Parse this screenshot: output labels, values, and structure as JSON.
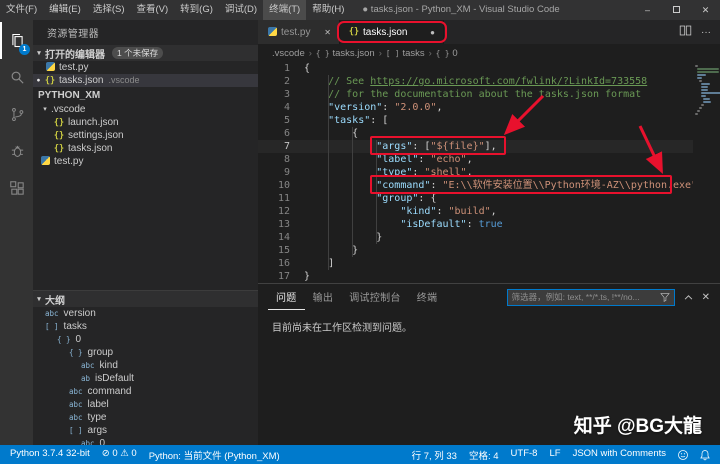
{
  "colors": {
    "accent": "#007acc",
    "annotation": "#e8112d"
  },
  "title_bar": {
    "menus": [
      {
        "id": "file",
        "label": "文件(F)"
      },
      {
        "id": "edit",
        "label": "编辑(E)"
      },
      {
        "id": "selection",
        "label": "选择(S)"
      },
      {
        "id": "view",
        "label": "查看(V)"
      },
      {
        "id": "go",
        "label": "转到(G)"
      },
      {
        "id": "debug",
        "label": "调试(D)"
      },
      {
        "id": "terminal",
        "label": "终端(T)",
        "highlight": true
      },
      {
        "id": "help",
        "label": "帮助(H)"
      }
    ],
    "window_title": "● tasks.json - Python_XM - Visual Studio Code"
  },
  "activity_bar": {
    "icons": [
      {
        "name": "explorer",
        "active": true,
        "badge": "1"
      },
      {
        "name": "search",
        "active": false
      },
      {
        "name": "source-control",
        "active": false
      },
      {
        "name": "debug",
        "active": false
      },
      {
        "name": "extensions",
        "active": false
      }
    ]
  },
  "explorer": {
    "title": "资源管理器",
    "open_editors": {
      "label": "打开的编辑器",
      "badge": "1 个未保存",
      "items": [
        {
          "icon": "python",
          "name": "test.py",
          "dirty": false,
          "selected": false
        },
        {
          "icon": "json",
          "name": "tasks.json",
          "detail": ".vscode",
          "dirty": true,
          "selected": true
        }
      ]
    },
    "folder": {
      "name": "PYTHON_XM",
      "items": [
        {
          "icon": "folder",
          "name": ".vscode",
          "level": 0,
          "expanded": true
        },
        {
          "icon": "json",
          "name": "launch.json",
          "level": 1
        },
        {
          "icon": "json",
          "name": "settings.json",
          "level": 1
        },
        {
          "icon": "json",
          "name": "tasks.json",
          "level": 1
        },
        {
          "icon": "python",
          "name": "test.py",
          "level": 0
        }
      ]
    }
  },
  "outline": {
    "title": "大纲",
    "items": [
      {
        "icon": "string",
        "name": "version",
        "level": 0
      },
      {
        "icon": "array",
        "name": "tasks",
        "level": 0
      },
      {
        "icon": "object",
        "name": "0",
        "level": 1
      },
      {
        "icon": "object",
        "name": "group",
        "level": 2
      },
      {
        "icon": "string",
        "name": "kind",
        "level": 3
      },
      {
        "icon": "boolean",
        "name": "isDefault",
        "level": 3
      },
      {
        "icon": "string",
        "name": "command",
        "level": 2
      },
      {
        "icon": "string",
        "name": "label",
        "level": 2
      },
      {
        "icon": "string",
        "name": "type",
        "level": 2
      },
      {
        "icon": "array",
        "name": "args",
        "level": 2
      },
      {
        "icon": "string",
        "name": "0",
        "level": 3
      }
    ]
  },
  "editor": {
    "tabs": [
      {
        "icon": "python",
        "name": "test.py",
        "active": false,
        "dirty": false
      },
      {
        "icon": "json",
        "name": "tasks.json",
        "active": true,
        "dirty": true
      }
    ],
    "breadcrumbs": [
      {
        "icon": "",
        "label": ".vscode"
      },
      {
        "icon": "json",
        "label": "tasks.json"
      },
      {
        "icon": "array",
        "label": "tasks"
      },
      {
        "icon": "object",
        "label": "0"
      }
    ],
    "lines": [
      {
        "n": 1,
        "tokens": [
          [
            "{",
            "pn"
          ]
        ]
      },
      {
        "n": 2,
        "tokens": [
          [
            "    // See ",
            "com"
          ],
          [
            "https://go.microsoft.com/fwlink/?LinkId=733558",
            "lnk"
          ]
        ]
      },
      {
        "n": 3,
        "tokens": [
          [
            "    // for the documentation about the tasks.json format",
            "com"
          ]
        ]
      },
      {
        "n": 4,
        "tokens": [
          [
            "    ",
            "pn"
          ],
          [
            "\"version\"",
            "key"
          ],
          [
            ": ",
            "pn"
          ],
          [
            "\"2.0.0\"",
            "str"
          ],
          [
            ",",
            "pn"
          ]
        ]
      },
      {
        "n": 5,
        "tokens": [
          [
            "    ",
            "pn"
          ],
          [
            "\"tasks\"",
            "key"
          ],
          [
            ": [",
            "pn"
          ]
        ]
      },
      {
        "n": 6,
        "tokens": [
          [
            "        {",
            "pn"
          ]
        ]
      },
      {
        "n": 7,
        "current": true,
        "tokens": [
          [
            "            ",
            "pn"
          ],
          [
            "\"args\"",
            "key"
          ],
          [
            ": [",
            "pn"
          ],
          [
            "\"${file}\"",
            "str"
          ],
          [
            "],",
            "pn"
          ]
        ]
      },
      {
        "n": 8,
        "tokens": [
          [
            "            ",
            "pn"
          ],
          [
            "\"label\"",
            "key"
          ],
          [
            ": ",
            "pn"
          ],
          [
            "\"echo\"",
            "str"
          ],
          [
            ",",
            "pn"
          ]
        ]
      },
      {
        "n": 9,
        "tokens": [
          [
            "            ",
            "pn"
          ],
          [
            "\"type\"",
            "key"
          ],
          [
            ": ",
            "pn"
          ],
          [
            "\"shell\"",
            "str"
          ],
          [
            ",",
            "pn"
          ]
        ]
      },
      {
        "n": 10,
        "tokens": [
          [
            "            ",
            "pn"
          ],
          [
            "\"command\"",
            "key"
          ],
          [
            ": ",
            "pn"
          ],
          [
            "\"E:\\\\软件安装位置\\\\Python环境-AZ\\\\python.exe\"",
            "str"
          ],
          [
            ",",
            "pn"
          ]
        ]
      },
      {
        "n": 11,
        "tokens": [
          [
            "            ",
            "pn"
          ],
          [
            "\"group\"",
            "key"
          ],
          [
            ": {",
            "pn"
          ]
        ]
      },
      {
        "n": 12,
        "tokens": [
          [
            "                ",
            "pn"
          ],
          [
            "\"kind\"",
            "key"
          ],
          [
            ": ",
            "pn"
          ],
          [
            "\"build\"",
            "str"
          ],
          [
            ",",
            "pn"
          ]
        ]
      },
      {
        "n": 13,
        "tokens": [
          [
            "                ",
            "pn"
          ],
          [
            "\"isDefault\"",
            "key"
          ],
          [
            ": ",
            "pn"
          ],
          [
            "true",
            "kw"
          ]
        ]
      },
      {
        "n": 14,
        "tokens": [
          [
            "            }",
            "pn"
          ]
        ]
      },
      {
        "n": 15,
        "tokens": [
          [
            "        }",
            "pn"
          ]
        ]
      },
      {
        "n": 16,
        "tokens": [
          [
            "    ]",
            "pn"
          ]
        ]
      },
      {
        "n": 17,
        "tokens": [
          [
            "}",
            "pn"
          ]
        ]
      }
    ]
  },
  "panel": {
    "tabs": [
      {
        "label": "问题",
        "active": true
      },
      {
        "label": "输出",
        "active": false
      },
      {
        "label": "调试控制台",
        "active": false
      },
      {
        "label": "终端",
        "active": false
      }
    ],
    "filter_placeholder": "筛选器，例如: text, **/*.ts, !**/no...",
    "message": "目前尚未在工作区检测到问题。"
  },
  "status_bar": {
    "left": [
      {
        "id": "python-version",
        "label": "Python 3.7.4 32-bit"
      },
      {
        "id": "problems",
        "label": "⊘ 0  ⚠ 0"
      },
      {
        "id": "python-scope",
        "label": "Python: 当前文件 (Python_XM)"
      }
    ],
    "right": [
      {
        "id": "cursor-position",
        "label": "行 7, 列 33"
      },
      {
        "id": "indentation",
        "label": "空格: 4"
      },
      {
        "id": "encoding",
        "label": "UTF-8"
      },
      {
        "id": "eol",
        "label": "LF"
      },
      {
        "id": "language-mode",
        "label": "JSON with Comments"
      }
    ]
  },
  "watermark": {
    "text": "知乎 @BG大龍"
  }
}
